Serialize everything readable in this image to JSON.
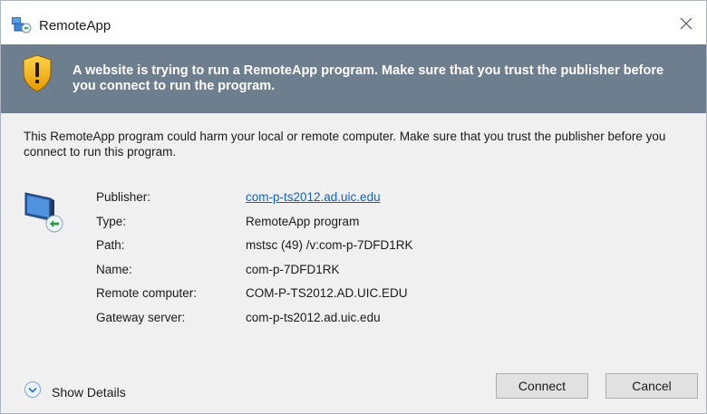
{
  "window": {
    "title": "RemoteApp",
    "close_icon": "close-icon"
  },
  "banner": {
    "icon": "warning-shield-icon",
    "message": "A website is trying to run a RemoteApp program. Make sure that you trust the publisher before you connect to run the program."
  },
  "body": {
    "warning": "This RemoteApp program could harm your local or remote computer. Make sure that you trust the publisher before you connect to run this program."
  },
  "details": {
    "icon": "remoteapp-computer-icon",
    "rows": [
      {
        "label": "Publisher:",
        "value": "com-p-ts2012.ad.uic.edu"
      },
      {
        "label": "Type:",
        "value": "RemoteApp program"
      },
      {
        "label": "Path:",
        "value": "mstsc (49) /v:com-p-7DFD1RK"
      },
      {
        "label": "Name:",
        "value": "com-p-7DFD1RK"
      },
      {
        "label": "Remote computer:",
        "value": "COM-P-TS2012.AD.UIC.EDU"
      },
      {
        "label": "Gateway server:",
        "value": "com-p-ts2012.ad.uic.edu"
      }
    ]
  },
  "footer": {
    "show_details_label": "Show Details",
    "connect_label": "Connect",
    "cancel_label": "Cancel"
  },
  "colors": {
    "banner_bg": "#6d7e8f",
    "link": "#0b63c9",
    "dialog_bg": "#f0f0f0"
  }
}
